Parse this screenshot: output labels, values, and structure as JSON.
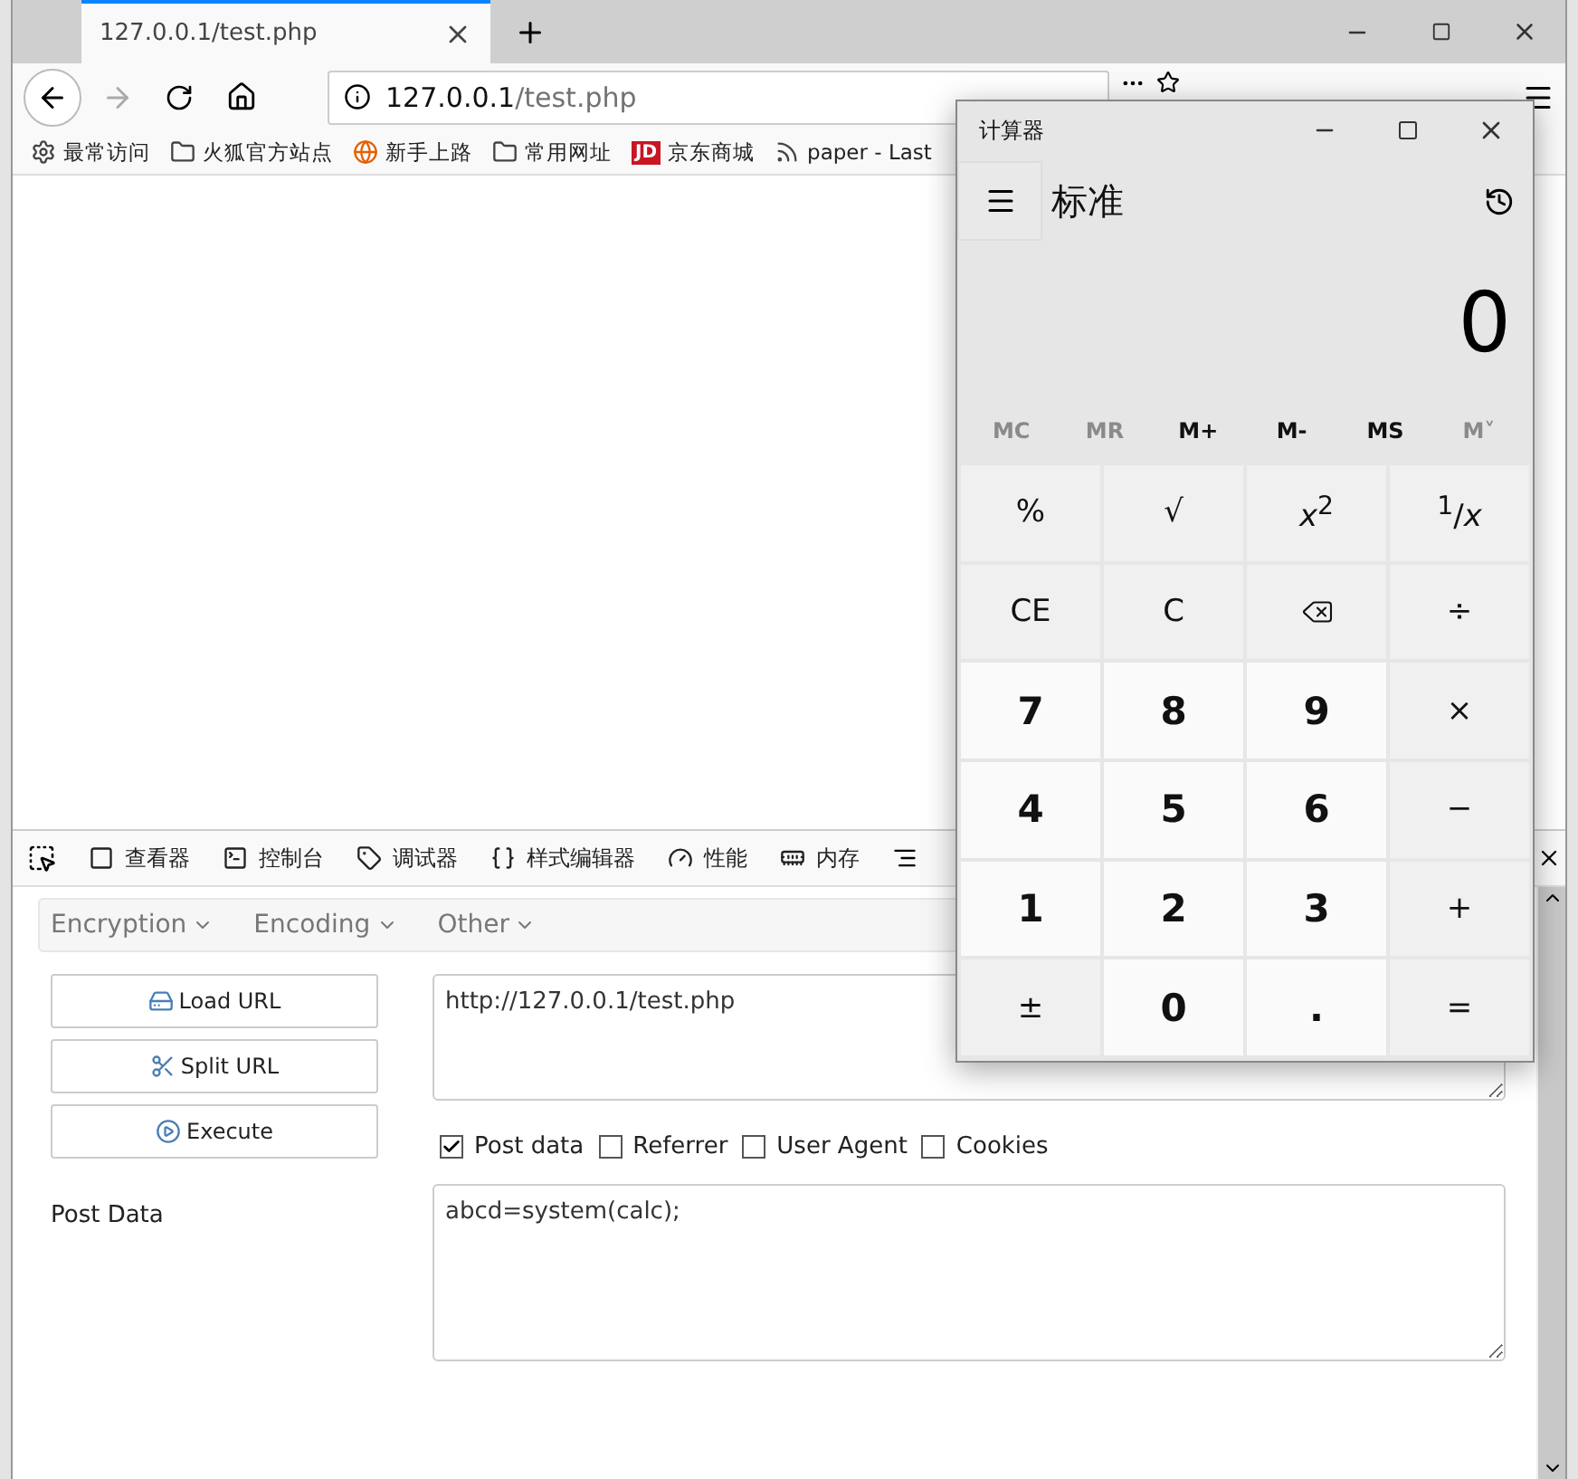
{
  "browser": {
    "tab": {
      "title": "127.0.0.1/test.php"
    },
    "url": {
      "host": "127.0.0.1",
      "path": "/test.php"
    },
    "bookmarks": [
      {
        "label": "最常访问",
        "kind": "gear"
      },
      {
        "label": "火狐官方站点",
        "kind": "folder"
      },
      {
        "label": "新手上路",
        "kind": "globe"
      },
      {
        "label": "常用网址",
        "kind": "folder"
      },
      {
        "label": "京东商城",
        "kind": "badge",
        "badge": "JD"
      },
      {
        "label": "paper - Last",
        "kind": "feed"
      }
    ]
  },
  "devtools": {
    "tabs": [
      {
        "label": "查看器",
        "kind": "inspector"
      },
      {
        "label": "控制台",
        "kind": "console"
      },
      {
        "label": "调试器",
        "kind": "debugger"
      },
      {
        "label": "样式编辑器",
        "kind": "style"
      },
      {
        "label": "性能",
        "kind": "performance"
      },
      {
        "label": "内存",
        "kind": "memory"
      }
    ]
  },
  "hackbar": {
    "menus": [
      "Encryption",
      "Encoding",
      "Other"
    ],
    "buttons": [
      {
        "label": "Load URL",
        "kind": "load"
      },
      {
        "label": "Split URL",
        "kind": "split"
      },
      {
        "label": "Execute",
        "kind": "execute"
      }
    ],
    "url": "http://127.0.0.1/test.php",
    "options": [
      {
        "label": "Post data",
        "checked": true
      },
      {
        "label": "Referrer",
        "checked": false
      },
      {
        "label": "User Agent",
        "checked": false
      },
      {
        "label": "Cookies",
        "checked": false
      }
    ],
    "post_label": "Post Data",
    "post_body": "abcd=system(calc);"
  },
  "calculator": {
    "title": "计算器",
    "mode": "标准",
    "display": "0",
    "memory": [
      {
        "label": "MC",
        "disabled": true
      },
      {
        "label": "MR",
        "disabled": true
      },
      {
        "label": "M+",
        "disabled": false
      },
      {
        "label": "M-",
        "disabled": false
      },
      {
        "label": "MS",
        "disabled": false
      },
      {
        "label": "M˅",
        "disabled": true
      }
    ],
    "keys": [
      {
        "label": "%",
        "kind": "op"
      },
      {
        "label": "√",
        "kind": "op"
      },
      {
        "label": "*x*$^{2}$",
        "kind": "op"
      },
      {
        "label": "$^{1}$/*x*",
        "kind": "op"
      },
      {
        "label": "CE",
        "kind": "op"
      },
      {
        "label": "C",
        "kind": "op"
      },
      {
        "kind": "backspace"
      },
      {
        "label": "÷",
        "kind": "op"
      },
      {
        "label": "7",
        "kind": "digit"
      },
      {
        "label": "8",
        "kind": "digit"
      },
      {
        "label": "9",
        "kind": "digit"
      },
      {
        "label": "×",
        "kind": "op"
      },
      {
        "label": "4",
        "kind": "digit"
      },
      {
        "label": "5",
        "kind": "digit"
      },
      {
        "label": "6",
        "kind": "digit"
      },
      {
        "label": "−",
        "kind": "op"
      },
      {
        "label": "1",
        "kind": "digit"
      },
      {
        "label": "2",
        "kind": "digit"
      },
      {
        "label": "3",
        "kind": "digit"
      },
      {
        "label": "+",
        "kind": "op"
      },
      {
        "label": "±",
        "kind": "op"
      },
      {
        "label": "0",
        "kind": "digit"
      },
      {
        "label": ".",
        "kind": "digit"
      },
      {
        "label": "=",
        "kind": "op"
      }
    ]
  }
}
